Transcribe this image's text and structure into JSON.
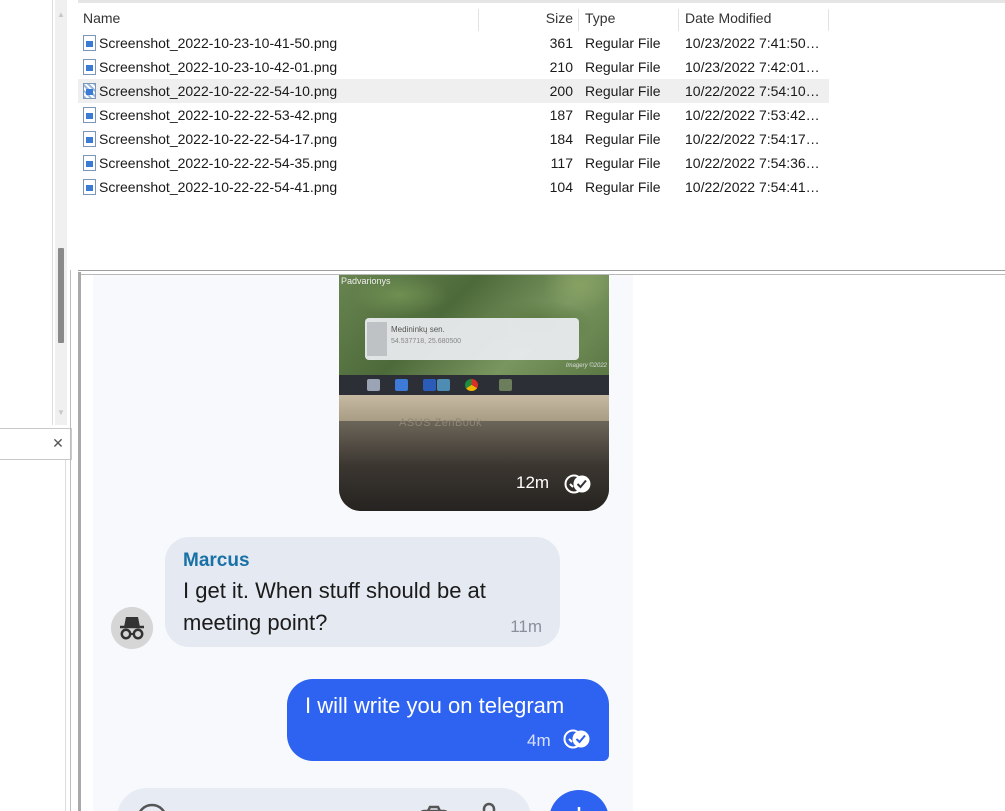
{
  "file_list": {
    "columns": {
      "name": "Name",
      "size": "Size",
      "type": "Type",
      "date": "Date Modified"
    },
    "rows": [
      {
        "name": "Screenshot_2022-10-23-10-41-50.png",
        "size": "361",
        "type": "Regular File",
        "date": "10/23/2022 7:41:50…"
      },
      {
        "name": "Screenshot_2022-10-23-10-42-01.png",
        "size": "210",
        "type": "Regular File",
        "date": "10/23/2022 7:42:01…"
      },
      {
        "name": "Screenshot_2022-10-22-22-54-10.png",
        "size": "200",
        "type": "Regular File",
        "date": "10/22/2022 7:54:10…"
      },
      {
        "name": "Screenshot_2022-10-22-22-53-42.png",
        "size": "187",
        "type": "Regular File",
        "date": "10/22/2022 7:53:42…"
      },
      {
        "name": "Screenshot_2022-10-22-22-54-17.png",
        "size": "184",
        "type": "Regular File",
        "date": "10/22/2022 7:54:17…"
      },
      {
        "name": "Screenshot_2022-10-22-22-54-35.png",
        "size": "117",
        "type": "Regular File",
        "date": "10/22/2022 7:54:36…"
      },
      {
        "name": "Screenshot_2022-10-22-22-54-41.png",
        "size": "104",
        "type": "Regular File",
        "date": "10/22/2022 7:54:41…"
      }
    ],
    "selected_index": 2
  },
  "chat": {
    "photo_message": {
      "map_label": "Padvarionys",
      "card_title": "Medininkų sen.",
      "card_coords": "54.537718, 25.680500",
      "imagery": "Imagery ©2022",
      "laptop_brand": "ASUS ZenBook",
      "time": "12m"
    },
    "incoming": {
      "sender": "Marcus",
      "text": "I get it. When stuff should be at meeting point?",
      "time": "11m"
    },
    "outgoing": {
      "text": "I will write you on telegram",
      "time": "4m"
    }
  },
  "colors": {
    "accent": "#2e62f0",
    "sender_name": "#1971a6",
    "incoming_bubble": "#e5e9f1",
    "chat_bg": "#f8f9fd"
  },
  "icons": {
    "avatar": "incognito-icon",
    "read_receipt": "double-check-icon",
    "close": "close-icon",
    "file": "image-file-icon"
  }
}
